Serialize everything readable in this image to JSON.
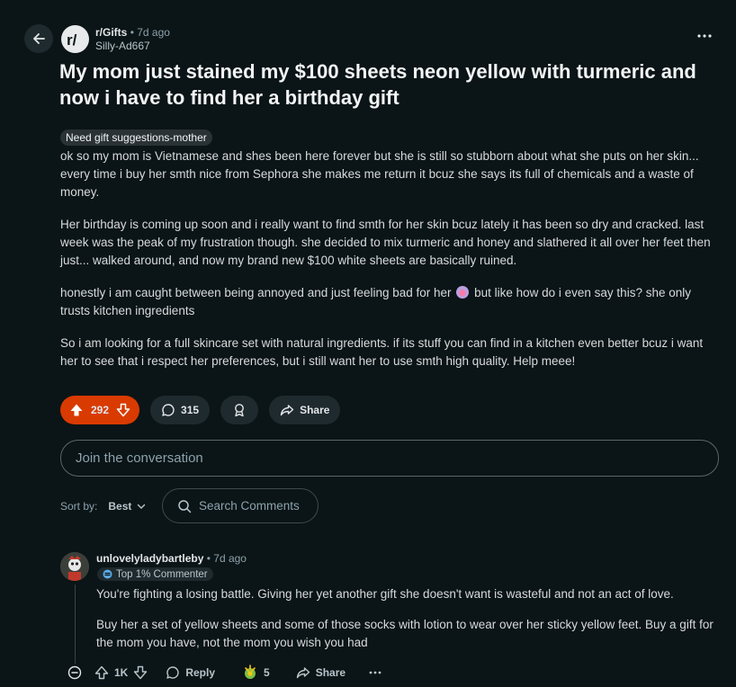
{
  "post": {
    "subreddit": "r/Gifts",
    "age_dot": "•",
    "age": "7d ago",
    "author": "Silly-Ad667",
    "title": "My mom just stained my $100 sheets neon yellow with turmeric and now i have to find her a birthday gift",
    "flair": "Need gift suggestions-mother",
    "paragraphs": [
      "ok so my mom is Vietnamese and shes been here forever but she is still so stubborn about what she puts on her skin... every time i buy her smth nice from Sephora she makes me return it bcuz she says its full of chemicals and a waste of money.",
      "Her birthday is coming up soon and i really want to find smth for her skin bcuz lately it has been so dry and cracked. last week was the peak of my frustration though. she decided to mix turmeric and honey and slathered it all over her feet then just... walked around, and now my brand new $100 white sheets are basically ruined.",
      "So i am looking for a full skincare set with natural ingredients. if its stuff you can find in a kitchen even better bcuz i want her to see that i respect her preferences, but i still want her to use smth high quality. Help meee!"
    ],
    "p3_before": "honestly i am caught between being annoyed and just feeling bad for her",
    "p3_after": "but like how do i even say this? she only trusts kitchen ingredients",
    "score": "292",
    "comments": "315",
    "share_label": "Share"
  },
  "composer": {
    "placeholder": "Join the conversation"
  },
  "sort": {
    "label": "Sort by:",
    "value": "Best"
  },
  "search": {
    "placeholder": "Search Comments"
  },
  "comment": {
    "author": "unlovelyladybartleby",
    "age_dot": "•",
    "age": "7d ago",
    "badge": "Top 1% Commenter",
    "paragraphs": [
      "You're fighting a losing battle. Giving her yet another gift she doesn't want is wasteful and not an act of love.",
      "Buy her a set of yellow sheets and some of those socks with lotion to wear over her sticky yellow feet. Buy a gift for the mom you have, not the mom you wish you had"
    ],
    "score": "1K",
    "reply_label": "Reply",
    "awards": "5",
    "share_label": "Share"
  },
  "colors": {
    "accent": "#d93a00",
    "background": "#0b1416",
    "pill": "#1f2a2e"
  },
  "icons": [
    "back-arrow-icon",
    "subreddit-logo-icon",
    "more-icon",
    "upvote-icon",
    "downvote-icon",
    "comment-icon",
    "award-icon",
    "share-icon",
    "search-icon",
    "chevron-down-icon",
    "collapse-icon",
    "reply-icon",
    "gold-award-icon",
    "top-commenter-icon"
  ]
}
